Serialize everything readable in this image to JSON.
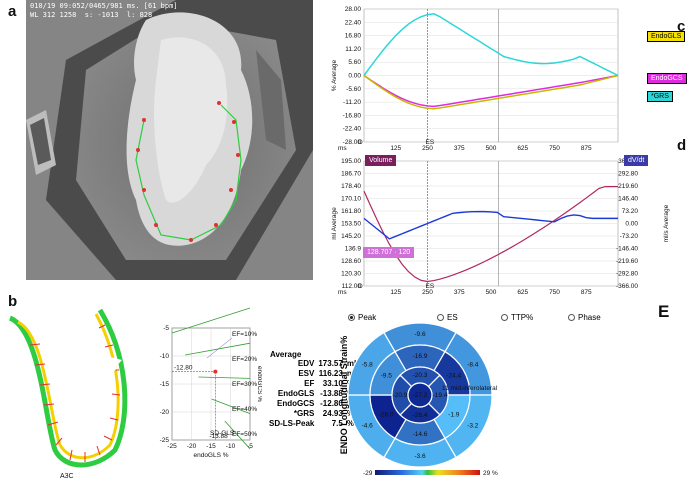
{
  "panels": {
    "a": "a",
    "b": "b",
    "c": "c",
    "d": "d",
    "e": "E"
  },
  "ct": {
    "header_line1": "010/19 09:052/0465/981 ms. [61 bpm]",
    "header_line2": "WL 312 1258  s: -1013  l: 828"
  },
  "strain_chart": {
    "y_ticks": [
      "28.00",
      "22.40",
      "16.80",
      "11.20",
      "5.60",
      "0.00",
      "-5.60",
      "-11.20",
      "-16.80",
      "-22.40",
      "-28.00"
    ],
    "x_ticks": [
      "125",
      "250",
      "375",
      "500",
      "625",
      "750",
      "875"
    ],
    "ylabel": "% Average",
    "x_unit": "ms",
    "es_label": "ES",
    "d_label": "D",
    "legend": [
      {
        "name": "EndoGLS",
        "color": "#f5e000"
      },
      {
        "name": "EndoGCS",
        "color": "#e02ae0"
      },
      {
        "name": "*GRS",
        "color": "#2ed7d7"
      }
    ]
  },
  "volume_chart": {
    "y_ticks_left": [
      "195.00",
      "186.70",
      "178.40",
      "170.10",
      "161.80",
      "153.50",
      "145.20",
      "136.9",
      "128.60",
      "120.30",
      "112.00"
    ],
    "y_ticks_right": [
      "366.00",
      "292.80",
      "219.60",
      "146.40",
      "73.20",
      "0.00",
      "-73.20",
      "-146.40",
      "-219.60",
      "-292.80",
      "-366.00"
    ],
    "x_ticks": [
      "125",
      "250",
      "375",
      "500",
      "625",
      "750",
      "875"
    ],
    "ylabel_left": "ml Average",
    "ylabel_right": "ml/s Average",
    "x_unit": "ms",
    "volume_label": "Volume",
    "dvdt_label": "dV/dt",
    "cursor_readout": "128.707 · 120",
    "es_label": "ES",
    "d_label": "D"
  },
  "contour_label": "A3C",
  "ef_plot": {
    "x_ticks": [
      "-25",
      "-20",
      "-15",
      "-10",
      "-5"
    ],
    "y_ticks": [
      "-5",
      "-10",
      "-15",
      "-20",
      "-25"
    ],
    "xlabel": "endoGLS %",
    "ylabel": "endoGCS %",
    "ef_lines": [
      "EF=10%",
      "EF=20%",
      "EF=30%",
      "EF=40%",
      "EF=50%"
    ],
    "marker_x_value": "-13.88",
    "marker_y_value": "-12.80",
    "sd_label": "SD-GLS"
  },
  "stats": {
    "title": "Average",
    "rows": [
      {
        "k": "EDV",
        "v": "173.57",
        "u": "ml"
      },
      {
        "k": "ESV",
        "v": "116.23",
        "u": "ml"
      },
      {
        "k": "EF",
        "v": "33.10",
        "u": "%"
      },
      {
        "k": "EndoGLS",
        "v": "-13.88",
        "u": "%"
      },
      {
        "k": "EndoGCS",
        "v": "-12.80",
        "u": "%"
      },
      {
        "k": "*GRS",
        "v": "24.93",
        "u": "%"
      },
      {
        "k": "SD-LS-Peak",
        "v": "7.5",
        "u": "%"
      }
    ]
  },
  "bullseye": {
    "options": [
      "Peak",
      "ES",
      "TTP%",
      "Phase"
    ],
    "selected": "Peak",
    "title": "ENDO Longitudinal Strain%",
    "scale_min": "-29",
    "scale_max": "29 %",
    "tooltip": "11 mid-inferolateral",
    "segments": {
      "s1": "-9.6",
      "s2": "-8.4",
      "s3": "-3.2",
      "s4": "-3.6",
      "s5": "-4.6",
      "s6": "-5.8",
      "s7": "-16.9",
      "s8": "-24.4",
      "s9": "-1.9",
      "s10": "-14.6",
      "s11": "-28.0",
      "s12": "-9.5",
      "s13": "-20.3",
      "s14": "-19.4",
      "s15": "-26.4",
      "s16": "-20.9",
      "s17": "-27.2"
    }
  }
}
